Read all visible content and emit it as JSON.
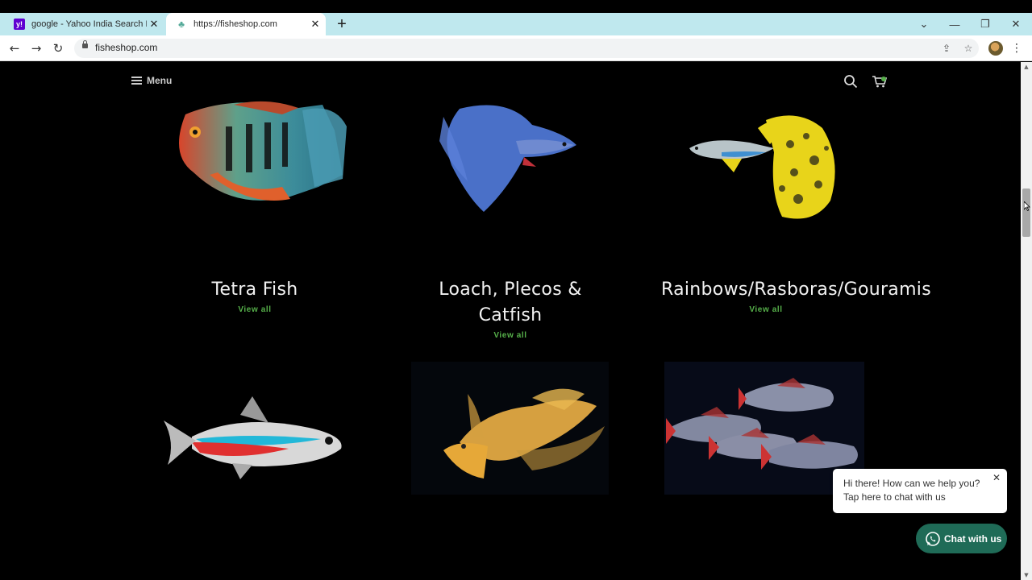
{
  "browser": {
    "tabs": [
      {
        "title": "google - Yahoo India Search Res",
        "favicon": "yahoo-icon",
        "active": false
      },
      {
        "title": "https://fisheshop.com",
        "favicon": "site-icon",
        "active": true
      }
    ],
    "url": "fisheshop.com",
    "window_controls": [
      "minimize",
      "restore",
      "close"
    ]
  },
  "header": {
    "menu_label": "Menu"
  },
  "categories": [
    {
      "title": "Tetra Fish",
      "link": "View all"
    },
    {
      "title_line1": "Loach, Plecos &",
      "title_line2": "Catfish",
      "link": "View all"
    },
    {
      "title": "Rainbows/Rasboras/Gouramis",
      "link": "View all"
    }
  ],
  "chat": {
    "message": "Hi there! How can we help you? Tap here to chat with us",
    "button_label": "Chat with us",
    "brand_color": "#1f6b57"
  },
  "colors": {
    "page_bg": "#000000",
    "link": "#56b04a",
    "tabstrip": "#bfe8ee"
  }
}
